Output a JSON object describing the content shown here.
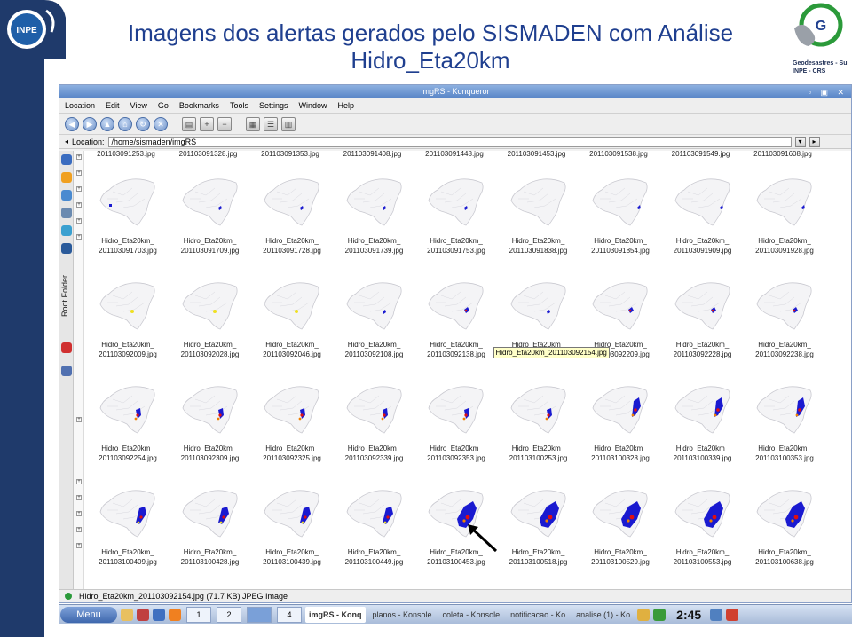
{
  "slide": {
    "title_line1": "Imagens dos alertas gerados pelo SISMADEN com Análise",
    "title_line2": "Hidro_Eta20km",
    "left_logo": "INPE",
    "right_logo_caption_line1": "Geodesastres - Sul",
    "right_logo_caption_line2": "INPE - CRS"
  },
  "window": {
    "title": "imgRS - Konqueror",
    "controls": "▫ ▣ ✕",
    "menu": [
      "Location",
      "Edit",
      "View",
      "Go",
      "Bookmarks",
      "Tools",
      "Settings",
      "Window",
      "Help"
    ],
    "location_label": "Location:",
    "location_value": "/home/sismaden/imgRS",
    "sidebar_folder_label": "Root Folder",
    "status_text": "Hidro_Eta20km_201103092154.jpg (71.7 KB)  JPEG Image"
  },
  "top_row_partial": [
    "201103091253.jpg",
    "201103091328.jpg",
    "201103091353.jpg",
    "201103091408.jpg",
    "201103091448.jpg",
    "201103091453.jpg",
    "201103091538.jpg",
    "201103091549.jpg",
    "201103091608.jpg"
  ],
  "rows": [
    [
      {
        "l1": "Hidro_Eta20km_",
        "l2": "201103091703.jpg",
        "alert": "blue-sw"
      },
      {
        "l1": "Hidro_Eta20km_",
        "l2": "201103091709.jpg",
        "alert": "blue-c"
      },
      {
        "l1": "Hidro_Eta20km_",
        "l2": "201103091728.jpg",
        "alert": "blue-c"
      },
      {
        "l1": "Hidro_Eta20km_",
        "l2": "201103091739.jpg",
        "alert": "blue-c"
      },
      {
        "l1": "Hidro_Eta20km_",
        "l2": "201103091753.jpg",
        "alert": "blue-c"
      },
      {
        "l1": "Hidro_Eta20km_",
        "l2": "201103091838.jpg",
        "alert": "none"
      },
      {
        "l1": "Hidro_Eta20km_",
        "l2": "201103091854.jpg",
        "alert": "blue-e"
      },
      {
        "l1": "Hidro_Eta20km_",
        "l2": "201103091909.jpg",
        "alert": "blue-e"
      },
      {
        "l1": "Hidro_Eta20km_",
        "l2": "201103091928.jpg",
        "alert": "blue-e"
      }
    ],
    [
      {
        "l1": "Hidro_Eta20km_",
        "l2": "201103092009.jpg",
        "alert": "yellow"
      },
      {
        "l1": "Hidro_Eta20km_",
        "l2": "201103092028.jpg",
        "alert": "yellow"
      },
      {
        "l1": "Hidro_Eta20km_",
        "l2": "201103092046.jpg",
        "alert": "yellow"
      },
      {
        "l1": "Hidro_Eta20km_",
        "l2": "201103092108.jpg",
        "alert": "blue-c"
      },
      {
        "l1": "Hidro_Eta20km_",
        "l2": "201103092138.jpg",
        "alert": "red-blue"
      },
      {
        "l1": "Hidro_Eta20km_",
        "l2": "201103092154.jpg",
        "alert": "blue-c"
      },
      {
        "l1": "Hidro_Eta20km_",
        "l2": "201103092209.jpg",
        "alert": "red-blue"
      },
      {
        "l1": "Hidro_Eta20km_",
        "l2": "201103092228.jpg",
        "alert": "red-blue"
      },
      {
        "l1": "Hidro_Eta20km_",
        "l2": "201103092238.jpg",
        "alert": "red-blue"
      }
    ],
    [
      {
        "l1": "Hidro_Eta20km_",
        "l2": "201103092254.jpg",
        "alert": "mixed"
      },
      {
        "l1": "Hidro_Eta20km_",
        "l2": "201103092309.jpg",
        "alert": "mixed"
      },
      {
        "l1": "Hidro_Eta20km_",
        "l2": "201103092325.jpg",
        "alert": "mixed"
      },
      {
        "l1": "Hidro_Eta20km_",
        "l2": "201103092339.jpg",
        "alert": "mixed"
      },
      {
        "l1": "Hidro_Eta20km_",
        "l2": "201103092353.jpg",
        "alert": "mixed"
      },
      {
        "l1": "Hidro_Eta20km_",
        "l2": "201103100253.jpg",
        "alert": "mixed"
      },
      {
        "l1": "Hidro_Eta20km_",
        "l2": "201103100328.jpg",
        "alert": "mixed2"
      },
      {
        "l1": "Hidro_Eta20km_",
        "l2": "201103100339.jpg",
        "alert": "mixed2"
      },
      {
        "l1": "Hidro_Eta20km_",
        "l2": "201103100353.jpg",
        "alert": "mixed2"
      }
    ],
    [
      {
        "l1": "Hidro_Eta20km_",
        "l2": "201103100409.jpg",
        "alert": "mixed3"
      },
      {
        "l1": "Hidro_Eta20km_",
        "l2": "201103100428.jpg",
        "alert": "mixed3"
      },
      {
        "l1": "Hidro_Eta20km_",
        "l2": "201103100439.jpg",
        "alert": "mixed3"
      },
      {
        "l1": "Hidro_Eta20km_",
        "l2": "201103100449.jpg",
        "alert": "mixed3"
      },
      {
        "l1": "Hidro_Eta20km_",
        "l2": "201103100453.jpg",
        "alert": "big"
      },
      {
        "l1": "Hidro_Eta20km_",
        "l2": "201103100518.jpg",
        "alert": "big"
      },
      {
        "l1": "Hidro_Eta20km_",
        "l2": "201103100529.jpg",
        "alert": "big"
      },
      {
        "l1": "Hidro_Eta20km_",
        "l2": "201103100553.jpg",
        "alert": "big"
      },
      {
        "l1": "Hidro_Eta20km_",
        "l2": "201103100638.jpg",
        "alert": "big"
      }
    ]
  ],
  "tooltip_text": "Hidro_Eta20km_201103092154.jpg",
  "taskbar": {
    "menu_label": "Menu",
    "desktops": [
      "1",
      "2",
      "",
      "4"
    ],
    "tasks": [
      "imgRS - Konq",
      "planos - Konsole",
      "coleta - Konsole",
      "notificacao - Ko",
      "analise (1) - Ko"
    ],
    "clock": "2:45"
  },
  "colors": {
    "title": "#1f3f8f",
    "alert_blue": "#1a1ad0",
    "alert_red": "#e01010",
    "alert_yellow": "#f0e020",
    "alert_orange": "#f08000"
  }
}
